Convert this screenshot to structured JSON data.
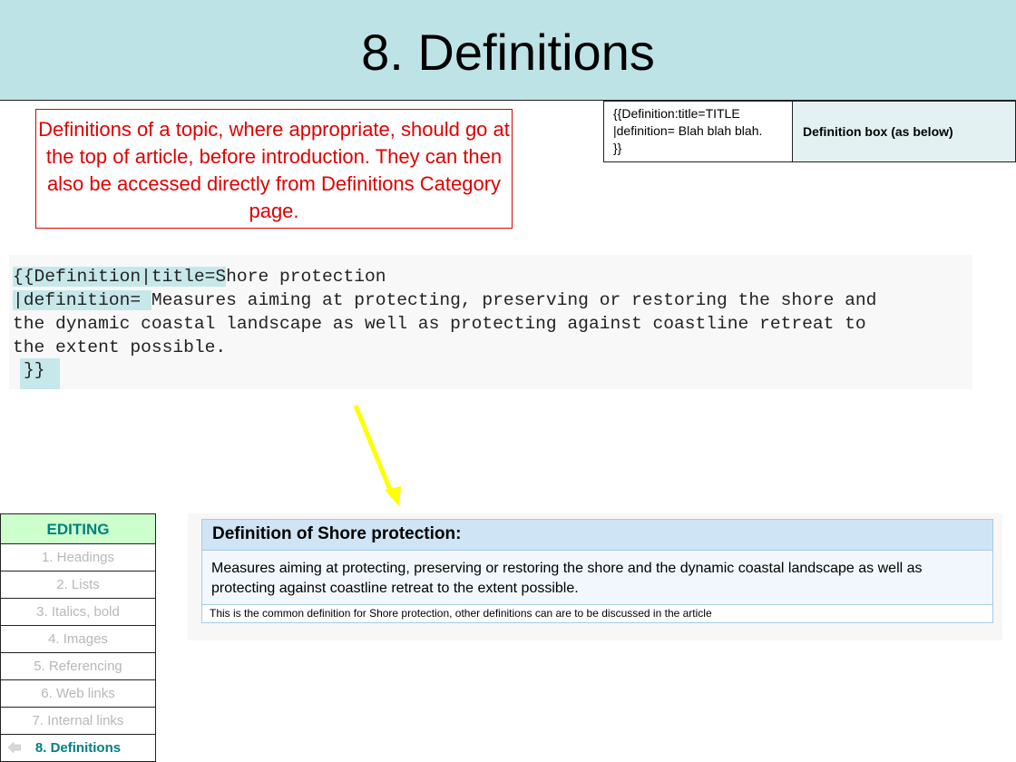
{
  "header": {
    "title": "8. Definitions"
  },
  "note": {
    "text": "Definitions of a topic, where appropriate, should go at the top of article, before introduction. They can then also be accessed directly from Definitions Category page."
  },
  "syntax_table": {
    "code": "{{Definition:title=TITLE\n|definition= Blah blah blah.\n}}",
    "description": "Definition box (as below)"
  },
  "code_example": {
    "line1_highlight": "{{Definition|title=S",
    "line1_rest": "hore protection",
    "line2_highlight": "|definition= ",
    "line2_rest": "Measures aiming at protecting, preserving or restoring the shore and",
    "line3": "the dynamic coastal landscape as well as protecting against coastline retreat to",
    "line4": "the extent possible.",
    "line5": "}}"
  },
  "definition_box": {
    "title": "Definition of Shore protection:",
    "body": "Measures aiming at protecting, preserving or restoring the shore and the dynamic coastal landscape as well as protecting against coastline retreat to the extent possible.",
    "footer": "This is the common definition for Shore protection, other definitions can are to be discussed in the article"
  },
  "nav": {
    "heading": "EDITING",
    "items": [
      "1. Headings",
      "2. Lists",
      "3. Italics, bold",
      "4. Images",
      "5. Referencing",
      "6. Web links",
      "7. Internal links",
      "8. Definitions"
    ],
    "active_index": 7
  },
  "icons": {
    "arrow": "down-arrow-icon",
    "back": "back-arrow-icon"
  },
  "colors": {
    "header_bg": "#bde3e6",
    "note_text": "#e00000",
    "arrow": "#ffff00",
    "nav_active": "#008080",
    "nav_heading_bg": "#ccffcc"
  }
}
